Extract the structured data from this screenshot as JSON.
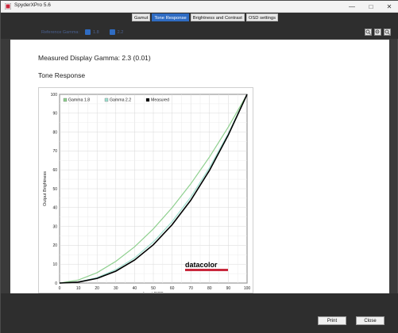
{
  "window": {
    "title": "SpyderXPro 5.6"
  },
  "tabs": [
    {
      "label": "Gamut",
      "active": false
    },
    {
      "label": "Tone Response",
      "active": true
    },
    {
      "label": "Brightness and Contrast",
      "active": false
    },
    {
      "label": "OSD settings",
      "active": false
    }
  ],
  "reference": {
    "label": "Reference Gamma:",
    "option1": "1.8",
    "option2": "2.2"
  },
  "measured_gamma": "Measured Display Gamma: 2.3 (0.01)",
  "section_title": "Tone Response",
  "buttons": {
    "print": "Print",
    "close": "Close"
  },
  "colors": {
    "accent": "#2f6cc3",
    "gamma18": "#8fd08f",
    "gamma22": "#9fe0d0",
    "measured": "#000000",
    "brand_bar": "#c8283c"
  },
  "chart_data": {
    "type": "line",
    "ylabel": "Output Brightness",
    "xlabel": "Input RGB",
    "xlim": [
      0,
      100
    ],
    "ylim": [
      0,
      100
    ],
    "x_ticks": [
      0,
      10,
      20,
      30,
      40,
      50,
      60,
      70,
      80,
      90,
      100
    ],
    "y_ticks": [
      0,
      10,
      20,
      30,
      40,
      50,
      60,
      70,
      80,
      90,
      100
    ],
    "grid": true,
    "legend_position": "top-left",
    "brand": "datacolor",
    "series": [
      {
        "name": "Gamma 1.8",
        "color": "#8fd08f",
        "x": [
          0,
          10,
          20,
          30,
          40,
          50,
          60,
          70,
          80,
          90,
          100
        ],
        "y": [
          0,
          1.6,
          5.5,
          11.5,
          19.2,
          28.7,
          39.9,
          52.6,
          66.9,
          82.7,
          100
        ]
      },
      {
        "name": "Gamma 2.2",
        "color": "#9fe0d0",
        "x": [
          0,
          10,
          20,
          30,
          40,
          50,
          60,
          70,
          80,
          90,
          100
        ],
        "y": [
          0,
          0.6,
          2.9,
          7.1,
          13.3,
          21.8,
          32.5,
          45.6,
          61.2,
          79.3,
          100
        ]
      },
      {
        "name": "Measured",
        "color": "#000000",
        "x": [
          0,
          10,
          20,
          30,
          40,
          50,
          60,
          70,
          80,
          90,
          100
        ],
        "y": [
          0,
          0.5,
          2.5,
          6.3,
          12.2,
          20.3,
          30.9,
          43.9,
          59.8,
          78.5,
          100
        ]
      }
    ]
  }
}
